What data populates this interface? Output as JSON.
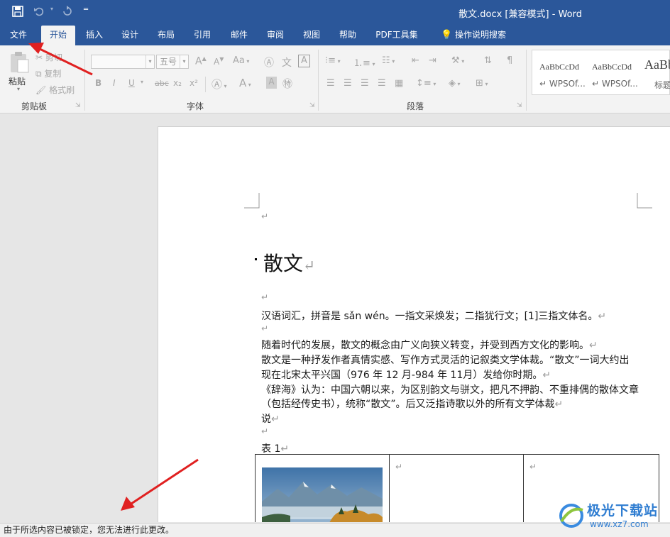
{
  "titlebar": {
    "document": "散文.docx [兼容模式]",
    "separator": "-",
    "app": "Word",
    "quick_access": {
      "save_icon": "save-icon",
      "undo_icon": "undo-icon",
      "redo_icon": "redo-icon",
      "customize_icon": "customize-qat-icon"
    }
  },
  "tabs": [
    "文件",
    "开始",
    "插入",
    "设计",
    "布局",
    "引用",
    "邮件",
    "审阅",
    "视图",
    "帮助",
    "PDF工具集"
  ],
  "active_tab": "开始",
  "tell_me": "操作说明搜索",
  "ribbon": {
    "clipboard": {
      "label": "剪贴板",
      "paste": "粘贴",
      "cut": "剪切",
      "copy": "复制",
      "format_painter": "格式刷"
    },
    "font": {
      "label": "字体",
      "font_size": "五号",
      "change_case": "Aa",
      "bold": "B",
      "italic": "I",
      "underline": "U",
      "strikethrough": "abc",
      "subscript": "x₂",
      "superscript": "x²"
    },
    "paragraph": {
      "label": "段落"
    },
    "styles": [
      {
        "sample": "AaBbCcDd",
        "name": "WPSOf..."
      },
      {
        "sample": "AaBbCcDd",
        "name": "WPSOf..."
      },
      {
        "sample": "AaBb",
        "name": "标题"
      }
    ]
  },
  "document": {
    "heading": "散文",
    "paragraph_mark": "↵",
    "lines": [
      "汉语词汇，拼音是 sǎn wén。一指文采焕发；二指犹行文；[1]三指文体名。",
      "随着时代的发展，散文的概念由广义向狭义转变，并受到西方文化的影响。",
      "散文是一种抒发作者真情实感、写作方式灵活的记叙类文学体裁。“散文”一词大约出",
      "现在北宋太平兴国（976 年 12 月-984 年 11月）发给你时期。",
      "《辞海》认为：中国六朝以来，为区别韵文与骈文，把凡不押韵、不重排偶的散体文章",
      "（包括经传史书），统称“散文”。后又泛指诗歌以外的所有文学体裁",
      "说"
    ],
    "table_caption": "表 1"
  },
  "statusbar": {
    "message": "由于所选内容已被锁定，您无法进行此更改。"
  },
  "watermark": {
    "text": "极光下载站",
    "url": "www.xz7.com"
  },
  "colors": {
    "title_bar": "#2b579a",
    "ribbon": "#f3f3f3",
    "workspace": "#e6e6e6",
    "arrow": "#e02020"
  }
}
